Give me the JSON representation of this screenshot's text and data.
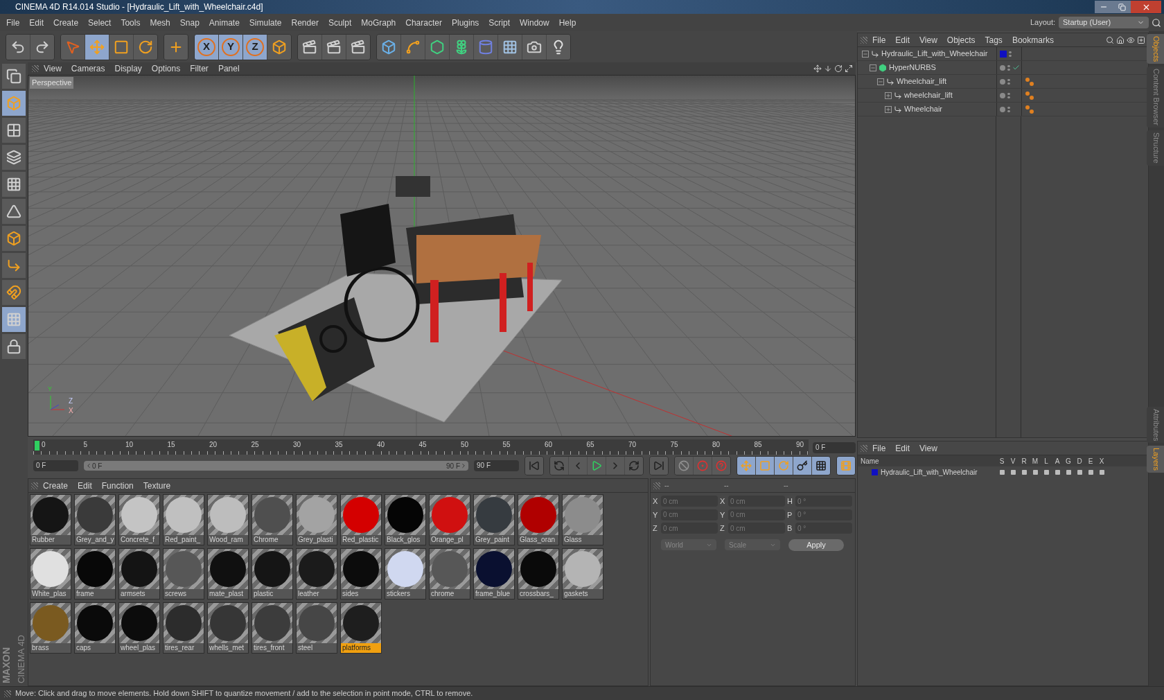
{
  "window": {
    "title": "CINEMA 4D R14.014 Studio - [Hydraulic_Lift_with_Wheelchair.c4d]"
  },
  "menu": [
    "File",
    "Edit",
    "Create",
    "Select",
    "Tools",
    "Mesh",
    "Snap",
    "Animate",
    "Simulate",
    "Render",
    "Sculpt",
    "MoGraph",
    "Character",
    "Plugins",
    "Script",
    "Window",
    "Help"
  ],
  "layout": {
    "label": "Layout:",
    "value": "Startup (User)"
  },
  "toolbar": [
    {
      "kind": "undo",
      "selected": false
    },
    {
      "kind": "redo",
      "selected": false
    },
    {
      "kind": "select",
      "selected": false
    },
    {
      "kind": "move",
      "selected": true
    },
    {
      "kind": "scale",
      "selected": false
    },
    {
      "kind": "rotate",
      "selected": false
    },
    {
      "kind": "add",
      "selected": false
    },
    {
      "kind": "axis",
      "label": "X",
      "selected": true
    },
    {
      "kind": "axis",
      "label": "Y",
      "selected": true
    },
    {
      "kind": "axis",
      "label": "Z",
      "selected": true
    },
    {
      "kind": "coords",
      "selected": false
    },
    {
      "kind": "render-view",
      "selected": false
    },
    {
      "kind": "render-picture",
      "selected": false
    },
    {
      "kind": "render-settings",
      "selected": false
    },
    {
      "kind": "cube",
      "selected": false
    },
    {
      "kind": "spline",
      "selected": false
    },
    {
      "kind": "nurbs",
      "selected": false
    },
    {
      "kind": "cloner",
      "selected": false
    },
    {
      "kind": "deformer",
      "selected": false
    },
    {
      "kind": "floor",
      "selected": false
    },
    {
      "kind": "camera",
      "selected": false
    },
    {
      "kind": "light",
      "selected": false
    }
  ],
  "left_tools": [
    {
      "kind": "make-editable",
      "selected": false
    },
    {
      "kind": "model",
      "selected": true
    },
    {
      "kind": "texture",
      "selected": false
    },
    {
      "kind": "workplane",
      "selected": false
    },
    {
      "kind": "points",
      "selected": false
    },
    {
      "kind": "edges",
      "selected": false
    },
    {
      "kind": "polygons",
      "selected": false
    },
    {
      "kind": "axis-mode",
      "selected": false
    },
    {
      "kind": "magnet",
      "selected": false
    },
    {
      "kind": "snap-grid",
      "selected": true
    },
    {
      "kind": "lock-grid",
      "selected": false
    }
  ],
  "viewport": {
    "menu": [
      "View",
      "Cameras",
      "Display",
      "Options",
      "Filter",
      "Panel"
    ],
    "camera": "Perspective",
    "axis_labels": [
      "Y",
      "Z",
      "X"
    ]
  },
  "timeline": {
    "ticks": [
      "0",
      "5",
      "10",
      "15",
      "20",
      "25",
      "30",
      "35",
      "40",
      "45",
      "50",
      "55",
      "60",
      "65",
      "70",
      "75",
      "80",
      "85",
      "90"
    ],
    "current": "0 F",
    "start": "0 F",
    "level": 1,
    "range_start": "0 F",
    "range_end": "90 F",
    "end": "90 F"
  },
  "playback": [
    {
      "kind": "go-start"
    },
    {
      "kind": "prev-key"
    },
    {
      "kind": "prev-frame"
    },
    {
      "kind": "play"
    },
    {
      "kind": "next-frame"
    },
    {
      "kind": "next-key"
    },
    {
      "kind": "go-end"
    },
    {
      "kind": "record"
    },
    {
      "kind": "auto-key"
    },
    {
      "kind": "help"
    },
    {
      "kind": "move"
    },
    {
      "kind": "scale"
    },
    {
      "kind": "rotate"
    },
    {
      "kind": "param"
    },
    {
      "kind": "points"
    },
    {
      "kind": "timeline"
    }
  ],
  "materials": {
    "menu": [
      "Create",
      "Edit",
      "Function",
      "Texture"
    ],
    "items": [
      {
        "name": "Rubber",
        "color": "#151515",
        "selected": false
      },
      {
        "name": "Grey_and_y",
        "color": "#3a3a3a",
        "selected": false
      },
      {
        "name": "Concrete_f",
        "color": "#c4c4c4",
        "selected": false
      },
      {
        "name": "Red_paint_",
        "color": "#c0c0c0",
        "selected": false
      },
      {
        "name": "Wood_ram",
        "color": "#bdbdbd",
        "selected": false
      },
      {
        "name": "Chrome",
        "color": "#4f4f4f",
        "selected": false
      },
      {
        "name": "Grey_plasti",
        "color": "#a3a3a3",
        "selected": false
      },
      {
        "name": "Red_plastic",
        "color": "#d40000",
        "selected": false
      },
      {
        "name": "Black_glos",
        "color": "#050505",
        "selected": false
      },
      {
        "name": "Orange_pl",
        "color": "#d01010",
        "selected": false
      },
      {
        "name": "Grey_paint",
        "color": "#363b40",
        "selected": false
      },
      {
        "name": "Glass_oran",
        "color": "#b00000",
        "selected": false
      },
      {
        "name": "Glass",
        "color": "#8c8c8c",
        "selected": false
      },
      {
        "name": "White_plas",
        "color": "#e0e0e0",
        "selected": false
      },
      {
        "name": "frame",
        "color": "#080808",
        "selected": false
      },
      {
        "name": "armsets",
        "color": "#141414",
        "selected": false
      },
      {
        "name": "screws",
        "color": "#575757",
        "selected": false
      },
      {
        "name": "mate_plast",
        "color": "#101010",
        "selected": false
      },
      {
        "name": "plastic",
        "color": "#151515",
        "selected": false
      },
      {
        "name": "leather",
        "color": "#1b1b1b",
        "selected": false
      },
      {
        "name": "sides",
        "color": "#0c0c0c",
        "selected": false
      },
      {
        "name": "stickers",
        "color": "#d0d8f0",
        "selected": false
      },
      {
        "name": "chrome",
        "color": "#575757",
        "selected": false
      },
      {
        "name": "frame_blue",
        "color": "#0a1030",
        "selected": false
      },
      {
        "name": "crossbars_",
        "color": "#0a0a0a",
        "selected": false
      },
      {
        "name": "gaskets",
        "color": "#b4b4b4",
        "selected": false
      },
      {
        "name": "brass",
        "color": "#7a5a20",
        "selected": false
      },
      {
        "name": "caps",
        "color": "#0a0a0a",
        "selected": false
      },
      {
        "name": "wheel_plas",
        "color": "#0c0c0c",
        "selected": false
      },
      {
        "name": "tires_rear",
        "color": "#2c2c2c",
        "selected": false
      },
      {
        "name": "whells_met",
        "color": "#363636",
        "selected": false
      },
      {
        "name": "tires_front",
        "color": "#3c3c3c",
        "selected": false
      },
      {
        "name": "steel",
        "color": "#464646",
        "selected": false
      },
      {
        "name": "platforms",
        "color": "#1e1e1e",
        "selected": true
      }
    ]
  },
  "coordinates": {
    "headers": [
      "--",
      "--",
      "--"
    ],
    "rows": [
      {
        "label_1": "X",
        "value_1": "0 cm",
        "label_2": "X",
        "value_2": "0 cm",
        "label_3": "H",
        "value_3": "0 °"
      },
      {
        "label_1": "Y",
        "value_1": "0 cm",
        "label_2": "Y",
        "value_2": "0 cm",
        "label_3": "P",
        "value_3": "0 °"
      },
      {
        "label_1": "Z",
        "value_1": "0 cm",
        "label_2": "Z",
        "value_2": "0 cm",
        "label_3": "B",
        "value_3": "0 °"
      }
    ],
    "mode": "World",
    "transform": "Scale",
    "apply": "Apply"
  },
  "objects": {
    "menu": [
      "File",
      "Edit",
      "View",
      "Objects",
      "Tags",
      "Bookmarks"
    ],
    "tree": [
      {
        "name": "Hydraulic_Lift_with_Wheelchair",
        "kind": "null",
        "expanded": true,
        "color": "#1010c0",
        "enabled": false,
        "tags": false,
        "children": [
          {
            "name": "HyperNURBS",
            "kind": "nurbs",
            "expanded": true,
            "enabled": true,
            "tags": false,
            "children": [
              {
                "name": "Wheelchair_lift",
                "kind": "null",
                "expanded": true,
                "enabled": false,
                "tags": true,
                "children": [
                  {
                    "name": "wheelchair_lift",
                    "kind": "null",
                    "expanded": false,
                    "enabled": false,
                    "tags": true
                  },
                  {
                    "name": "Wheelchair",
                    "kind": "null",
                    "expanded": false,
                    "enabled": false,
                    "tags": true
                  }
                ]
              }
            ]
          }
        ]
      }
    ]
  },
  "layers": {
    "menu": [
      "File",
      "Edit",
      "View"
    ],
    "columns": [
      "Name",
      "S",
      "V",
      "R",
      "M",
      "L",
      "A",
      "G",
      "D",
      "E",
      "X"
    ],
    "rows": [
      {
        "name": "Hydraulic_Lift_with_Wheelchair",
        "color": "#1010c0"
      }
    ]
  },
  "side_tabs_top": [
    {
      "label": "Objects",
      "selected": true
    },
    {
      "label": "Content Browser",
      "selected": false
    },
    {
      "label": "Structure",
      "selected": false
    }
  ],
  "side_tabs_bottom": [
    {
      "label": "Attributes",
      "selected": false
    },
    {
      "label": "Layers",
      "selected": true
    }
  ],
  "logo": {
    "brand": "MAXON",
    "product": "CINEMA 4D"
  },
  "status_bar": "Move: Click and drag to move elements. Hold down SHIFT to quantize movement / add to the selection in point mode, CTRL to remove."
}
